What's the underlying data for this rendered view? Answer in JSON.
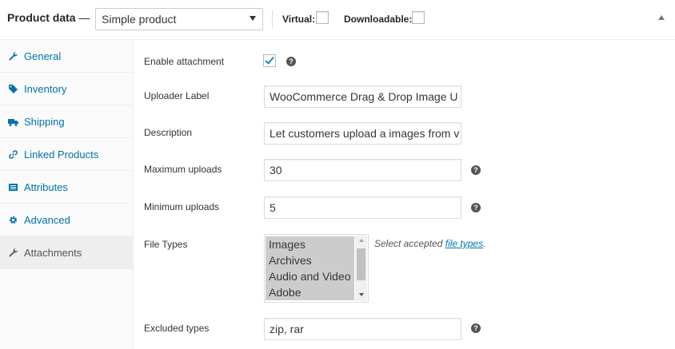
{
  "header": {
    "title": "Product data",
    "dash": " —",
    "product_type": "Simple product",
    "virtual_label": "Virtual:",
    "downloadable_label": "Downloadable:"
  },
  "sidebar": {
    "items": [
      {
        "label": "General",
        "icon": "wrench-icon"
      },
      {
        "label": "Inventory",
        "icon": "tag-icon"
      },
      {
        "label": "Shipping",
        "icon": "truck-icon"
      },
      {
        "label": "Linked Products",
        "icon": "link-icon"
      },
      {
        "label": "Attributes",
        "icon": "list-icon"
      },
      {
        "label": "Advanced",
        "icon": "gear-icon"
      },
      {
        "label": "Attachments",
        "icon": "wrench-icon"
      }
    ],
    "active_index": 6
  },
  "form": {
    "enable_attachment_label": "Enable attachment",
    "uploader_label": "Uploader Label",
    "uploader_value": "WooCommerce Drag & Drop Image U",
    "description_label": "Description",
    "description_value": "Let customers upload a images from v",
    "max_uploads_label": "Maximum uploads",
    "max_uploads_value": "30",
    "min_uploads_label": "Minimum uploads",
    "min_uploads_value": "5",
    "file_types_label": "File Types",
    "file_types_options": [
      "Images",
      "Archives",
      "Audio and Video",
      "Adobe"
    ],
    "file_types_desc_prefix": "Select accepted ",
    "file_types_desc_link": "file types",
    "file_types_desc_suffix": ".",
    "excluded_types_label": "Excluded types",
    "excluded_types_value": "zip, rar",
    "help_glyph": "?"
  },
  "colors": {
    "link": "#0073aa",
    "checkmark": "#1e8cbe"
  }
}
